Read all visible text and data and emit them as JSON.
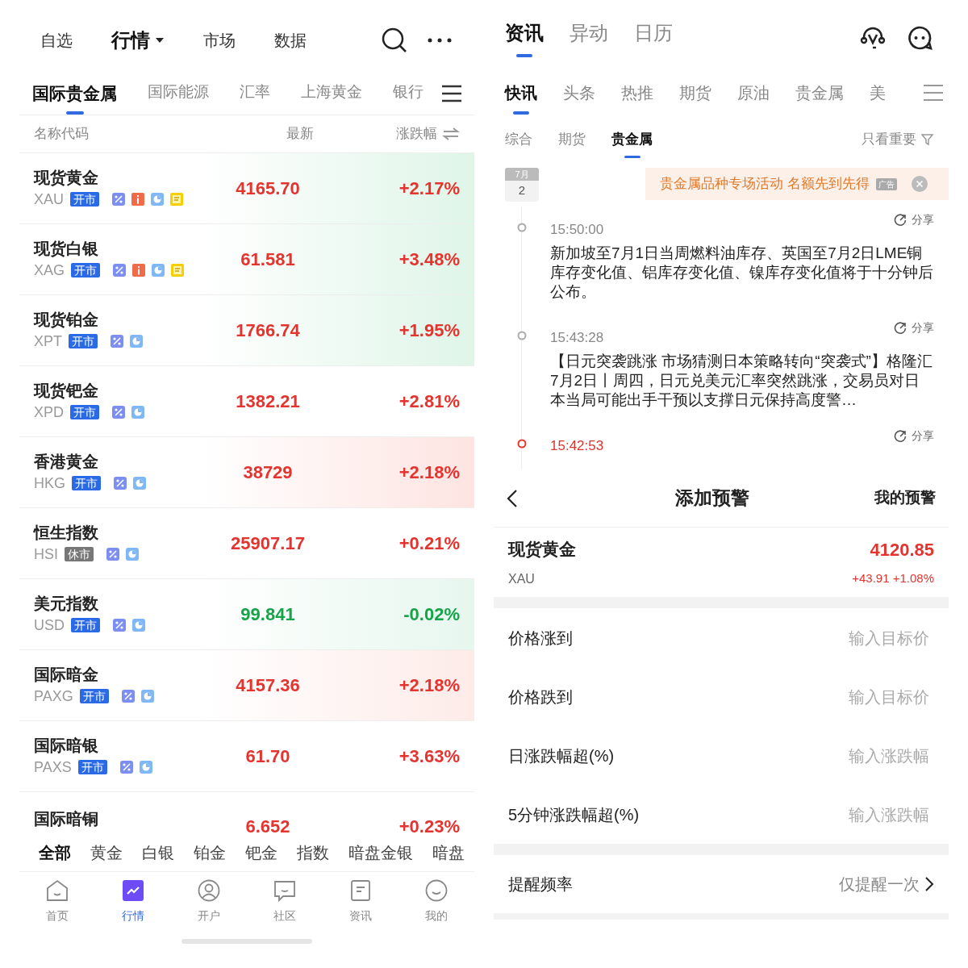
{
  "left": {
    "top_nav": [
      {
        "label": "自选",
        "selected": false
      },
      {
        "label": "行情",
        "selected": true
      },
      {
        "label": "市场",
        "selected": false
      },
      {
        "label": "数据",
        "selected": false
      }
    ],
    "tabs": [
      {
        "label": "国际贵金属",
        "selected": true
      },
      {
        "label": "国际能源",
        "selected": false
      },
      {
        "label": "汇率",
        "selected": false
      },
      {
        "label": "上海黄金",
        "selected": false
      },
      {
        "label": "银行",
        "selected": false
      }
    ],
    "columns": [
      "名称代码",
      "最新",
      "涨跌幅"
    ],
    "rows": [
      {
        "name": "现货黄金",
        "code": "XAU",
        "status": "开市",
        "open": true,
        "icons": [
          {
            "kind": "percent"
          },
          {
            "kind": "info"
          },
          {
            "kind": "pie"
          },
          {
            "kind": "note"
          }
        ],
        "price": "4165.70",
        "change": "+2.17%",
        "falling": false,
        "color": "#dff5e8"
      },
      {
        "name": "现货白银",
        "code": "XAG",
        "status": "开市",
        "open": true,
        "icons": [
          {
            "kind": "percent"
          },
          {
            "kind": "info"
          },
          {
            "kind": "pie"
          },
          {
            "kind": "note"
          }
        ],
        "price": "61.581",
        "change": "+3.48%",
        "falling": false,
        "color": "#dff5e8"
      },
      {
        "name": "现货铂金",
        "code": "XPT",
        "status": "开市",
        "open": true,
        "icons": [
          {
            "kind": "percent"
          },
          {
            "kind": "pie"
          }
        ],
        "price": "1766.74",
        "change": "+1.95%",
        "falling": false,
        "color": "#dff5e8"
      },
      {
        "name": "现货钯金",
        "code": "XPD",
        "status": "开市",
        "open": true,
        "icons": [
          {
            "kind": "percent"
          },
          {
            "kind": "pie"
          }
        ],
        "price": "1382.21",
        "change": "+2.81%",
        "falling": false
      },
      {
        "name": "香港黄金",
        "code": "HKG",
        "status": "开市",
        "open": true,
        "icons": [
          {
            "kind": "percent"
          },
          {
            "kind": "pie"
          }
        ],
        "price": "38729",
        "change": "+2.18%",
        "falling": false,
        "color": "#fde4e1"
      },
      {
        "name": "恒生指数",
        "code": "HSI",
        "status": "休市",
        "open": false,
        "icons": [
          {
            "kind": "percent"
          },
          {
            "kind": "pie"
          }
        ],
        "price": "25907.17",
        "change": "+0.21%",
        "falling": false
      },
      {
        "name": "美元指数",
        "code": "USD",
        "status": "开市",
        "open": true,
        "icons": [
          {
            "kind": "percent"
          },
          {
            "kind": "pie"
          }
        ],
        "price": "99.841",
        "change": "-0.02%",
        "falling": true,
        "color": "#e6f7ee"
      },
      {
        "name": "国际暗金",
        "code": "PAXG",
        "status": "开市",
        "open": true,
        "icons": [
          {
            "kind": "percent"
          },
          {
            "kind": "pie"
          }
        ],
        "price": "4157.36",
        "change": "+2.18%",
        "falling": false,
        "color": "#fdebe8"
      },
      {
        "name": "国际暗银",
        "code": "PAXS",
        "status": "开市",
        "open": true,
        "icons": [
          {
            "kind": "percent"
          },
          {
            "kind": "pie"
          }
        ],
        "price": "61.70",
        "change": "+3.63%",
        "falling": false
      },
      {
        "name": "国际暗铜",
        "price": "6.652",
        "change": "+0.23%",
        "falling": false
      }
    ],
    "filters": [
      {
        "label": "全部",
        "selected": true
      },
      {
        "label": "黄金",
        "selected": false
      },
      {
        "label": "白银",
        "selected": false
      },
      {
        "label": "铂金",
        "selected": false
      },
      {
        "label": "钯金",
        "selected": false
      },
      {
        "label": "指数",
        "selected": false
      },
      {
        "label": "暗盘金银",
        "selected": false
      },
      {
        "label": "暗盘",
        "selected": false
      }
    ],
    "bottom_nav": [
      {
        "label": "首页",
        "kind": "home",
        "selected": false
      },
      {
        "label": "行情",
        "kind": "chart",
        "selected": true
      },
      {
        "label": "开户",
        "kind": "person",
        "selected": false
      },
      {
        "label": "社区",
        "kind": "bubble",
        "selected": false
      },
      {
        "label": "资讯",
        "kind": "doc",
        "selected": false
      },
      {
        "label": "我的",
        "kind": "smile",
        "selected": false
      }
    ]
  },
  "right": {
    "top_tabs": [
      {
        "label": "资讯",
        "selected": true
      },
      {
        "label": "异动",
        "selected": false
      },
      {
        "label": "日历",
        "selected": false
      }
    ],
    "tabs": [
      {
        "label": "快讯",
        "selected": true
      },
      {
        "label": "头条",
        "selected": false
      },
      {
        "label": "热推",
        "selected": false
      },
      {
        "label": "期货",
        "selected": false
      },
      {
        "label": "原油",
        "selected": false
      },
      {
        "label": "贵金属",
        "selected": false
      },
      {
        "label": "美",
        "selected": false
      }
    ],
    "sub_tabs": [
      {
        "label": "综合",
        "selected": false
      },
      {
        "label": "期货",
        "selected": false
      },
      {
        "label": "贵金属",
        "selected": true
      }
    ],
    "important_only": "只看重要",
    "date": {
      "month": "7月",
      "day": "2"
    },
    "ad": {
      "text": "贵金属品种专场活动 名额先到先得",
      "badge": "广告"
    },
    "news": [
      {
        "time": "15:50:00",
        "share": "分享",
        "text": "新加坡至7月1日当周燃料油库存、英国至7月2日LME铜库存变化值、铝库存变化值、镍库存变化值将于十分钟后公布。",
        "important": false
      },
      {
        "time": "15:43:28",
        "share": "分享",
        "text": "【日元突袭跳涨 市场猜测日本策略转向“突袭式”】格隆汇7月2日丨周四，日元兑美元汇率突然跳涨，交易员对日本当局可能出手干预以支撑日元保持高度警…",
        "important": false
      },
      {
        "time": "15:42:53",
        "share": "分享",
        "important": true
      }
    ],
    "alert": {
      "title": "添加预警",
      "my_alerts": "我的预警",
      "quote": {
        "name": "现货黄金",
        "code": "XAU",
        "price": "4120.85",
        "change": "+43.91 +1.08%"
      },
      "fields": [
        {
          "label": "价格涨到",
          "placeholder": "输入目标价"
        },
        {
          "label": "价格跌到",
          "placeholder": "输入目标价"
        },
        {
          "label": "日涨跌幅超(%)",
          "placeholder": "输入涨跌幅"
        },
        {
          "label": "5分钟涨跌幅超(%)",
          "placeholder": "输入涨跌幅"
        }
      ],
      "frequency": {
        "label": "提醒频率",
        "value": "仅提醒一次"
      }
    }
  }
}
